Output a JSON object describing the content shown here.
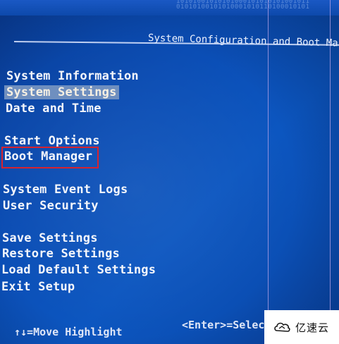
{
  "header": {
    "title": "System Configuration and Boot Mana"
  },
  "background_binary": "10101001010101000101010101001011\n01010100101010001010110100010101",
  "menu": {
    "system_information": "System Information",
    "system_settings": "System Settings",
    "date_and_time": "Date and Time",
    "start_options": "Start Options",
    "boot_manager": "Boot Manager",
    "system_event_logs": "System Event Logs",
    "user_security": "User Security",
    "save_settings": "Save Settings",
    "restore_settings": "Restore Settings",
    "load_default_settings": "Load Default Settings",
    "exit_setup": "Exit Setup"
  },
  "footer": {
    "move_hint": "↑↓=Move Highlight",
    "enter_hint": "<Enter>=Select"
  },
  "watermark": {
    "text": "亿速云",
    "icon": "cloud-logo-icon"
  },
  "colors": {
    "background": "#0b4db4",
    "text": "#f4f6fb",
    "highlight": "#6f8fbf",
    "red_box": "#d8232f",
    "guide_line": "#b9a4e8"
  }
}
